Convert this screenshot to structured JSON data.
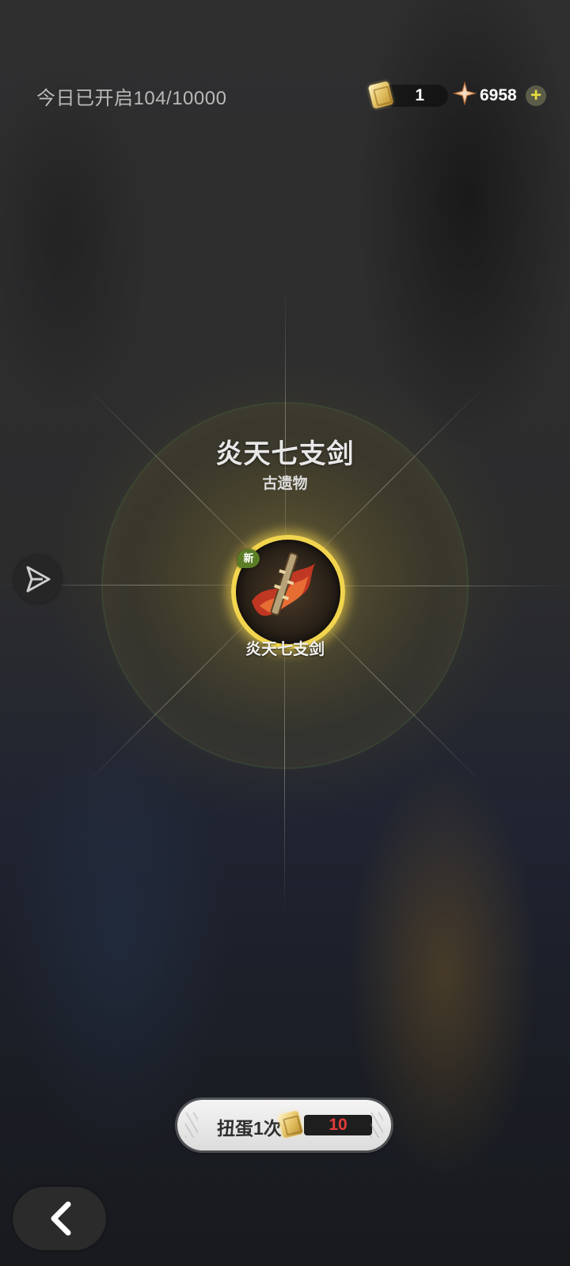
{
  "header": {
    "daily_opened": "今日已开启104/10000",
    "ticket_count": "1",
    "gem_count": "6958",
    "add_symbol": "+"
  },
  "reward": {
    "title": "炎天七支剑",
    "category": "古遗物",
    "badge": "新",
    "item_label": "炎天七支剑"
  },
  "actions": {
    "gacha_label": "扭蛋1次",
    "gacha_cost": "10"
  },
  "icons": {
    "ticket": "gacha-ticket-icon",
    "gem": "star-crystal-icon",
    "share": "share-send-icon",
    "back": "back-arrow-icon",
    "item": "flame-sword-icon"
  }
}
